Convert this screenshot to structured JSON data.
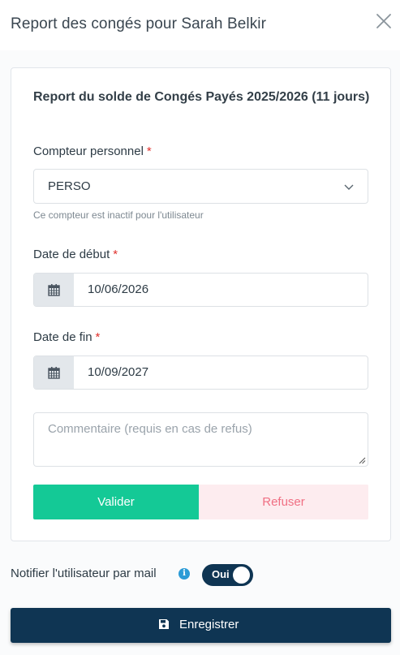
{
  "modal": {
    "title": "Report des congés pour Sarah Belkir",
    "close_icon": "close-icon"
  },
  "form": {
    "heading": "Report du solde de Congés Payés 2025/2026 (11 jours)",
    "required_marker": "*",
    "counter": {
      "label": "Compteur personnel",
      "value": "PERSO",
      "hint": "Ce compteur est inactif pour l'utilisateur"
    },
    "start_date": {
      "label": "Date de début",
      "value": "10/06/2026"
    },
    "end_date": {
      "label": "Date de fin",
      "value": "10/09/2027"
    },
    "comment": {
      "placeholder": "Commentaire (requis en cas de refus)",
      "value": ""
    },
    "validate_label": "Valider",
    "refuse_label": "Refuser"
  },
  "notify": {
    "label": "Notifier l'utilisateur par mail",
    "info_icon": "i",
    "toggle_label": "Oui",
    "toggle_on": true
  },
  "save": {
    "label": "Enregistrer",
    "icon": "floppy-disk-icon"
  },
  "colors": {
    "primary": "#0f3553",
    "success": "#14c996",
    "danger_bg": "#fdecef",
    "danger_text": "#f06f83",
    "required": "#e0312d",
    "info": "#2b9bd6"
  }
}
